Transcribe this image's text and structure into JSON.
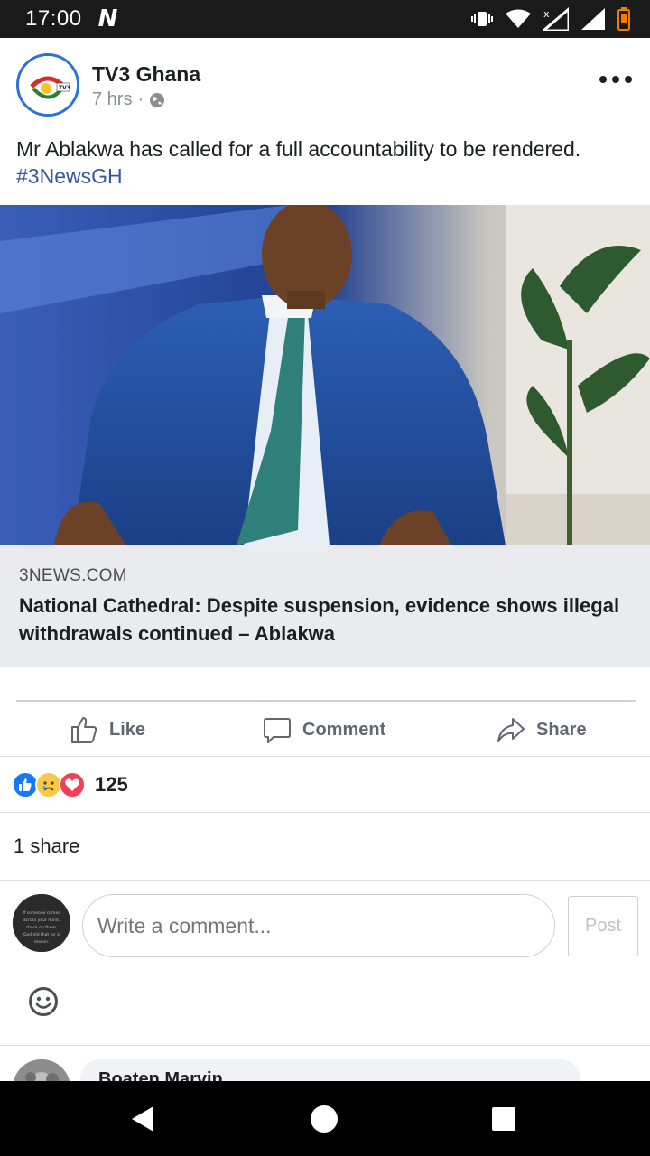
{
  "status_bar": {
    "time": "17:00",
    "notification_letter": "N"
  },
  "post": {
    "author": "TV3 Ghana",
    "time": "7 hrs",
    "separator": "·",
    "text": "Mr Ablakwa has called for a full accountability to be rendered.",
    "hashtag": "#3NewsGH",
    "avatar_logo_text": "TV3"
  },
  "link_preview": {
    "domain": "3NEWS.COM",
    "title": "National Cathedral: Despite suspension, evidence shows illegal withdrawals continued – Ablakwa"
  },
  "actions": {
    "like": "Like",
    "comment": "Comment",
    "share": "Share"
  },
  "reactions": {
    "count": "125",
    "types": [
      "like-icon",
      "sad-icon",
      "love-icon"
    ]
  },
  "shares": {
    "label": "1 share"
  },
  "comment_box": {
    "placeholder": "Write a comment...",
    "post_label": "Post",
    "avatar_text": "If someone comes across your mind, check on them. God did that for a reason."
  },
  "next_comment": {
    "name": "Boaten Marvin"
  },
  "colors": {
    "accent": "#385898",
    "avatar_ring": "#2a73d6",
    "like_blue": "#1877f2",
    "love_red": "#f33e58"
  }
}
